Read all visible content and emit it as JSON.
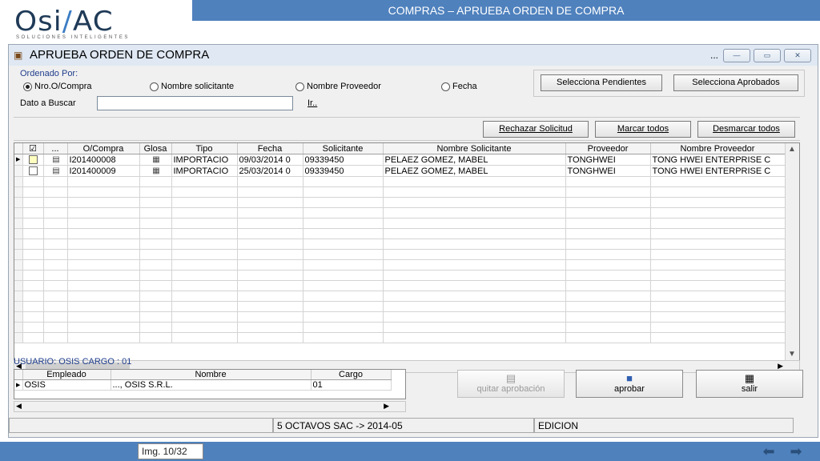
{
  "logo": {
    "brand_left": "Osi",
    "brand_slash": "/",
    "brand_right": "AC",
    "tagline": "SOLUCIONES INTELIGENTES"
  },
  "slide_title": "COMPRAS – APRUEBA ORDEN DE COMPRA",
  "window": {
    "title": "APRUEBA ORDEN DE COMPRA",
    "ctrl_dots": "...",
    "order_label": "Ordenado Por:",
    "radios": [
      {
        "label": "Nro.O/Compra",
        "selected": true
      },
      {
        "label": "Nombre solicitante",
        "selected": false
      },
      {
        "label": "Nombre Proveedor",
        "selected": false
      },
      {
        "label": "Fecha",
        "selected": false
      }
    ],
    "pending_btn": "Selecciona Pendientes",
    "approved_btn": "Selecciona Aprobados",
    "search_label": "Dato a Buscar",
    "search_value": "",
    "ir_link": "Ir..",
    "reject_btn": "Rechazar Solicitud",
    "mark_all_btn": "Marcar todos",
    "unmark_all_btn": "Desmarcar todos"
  },
  "grid": {
    "headers": [
      "☑",
      "...",
      "O/Compra",
      "Glosa",
      "Tipo",
      "Fecha",
      "Solicitante",
      "Nombre Solicitante",
      "Proveedor",
      "Nombre Proveedor"
    ],
    "rows": [
      {
        "checked": false,
        "ocompra": "I201400008",
        "tipo": "IMPORTACIO",
        "fecha": "09/03/2014 0",
        "solicitante": "09339450",
        "nombre_solicitante": "PELAEZ GOMEZ, MABEL",
        "proveedor": "TONGHWEI",
        "nombre_proveedor": "TONG HWEI ENTERPRISE C"
      },
      {
        "checked": false,
        "ocompra": "I201400009",
        "tipo": "IMPORTACIO",
        "fecha": "25/03/2014 0",
        "solicitante": "09339450",
        "nombre_solicitante": "PELAEZ GOMEZ, MABEL",
        "proveedor": "TONGHWEI",
        "nombre_proveedor": "TONG HWEI ENTERPRISE C"
      }
    ]
  },
  "user_line": "USUARIO: OSIS  CARGO : 01",
  "lower_grid": {
    "headers": [
      "Empleado",
      "Nombre",
      "Cargo"
    ],
    "rows": [
      {
        "empleado": "OSIS",
        "nombre": "..., OSIS S.R.L.",
        "cargo": "01"
      }
    ]
  },
  "buttons": {
    "quitar": "quitar aprobación",
    "aprobar": "aprobar",
    "salir": "salir"
  },
  "status": {
    "period": "5 OCTAVOS SAC -> 2014-05",
    "mode": "EDICION"
  },
  "footer": {
    "img_label": "Img. 10/32"
  },
  "colors": {
    "accent": "#4f81bd",
    "label_blue": "#1f3e8c"
  }
}
